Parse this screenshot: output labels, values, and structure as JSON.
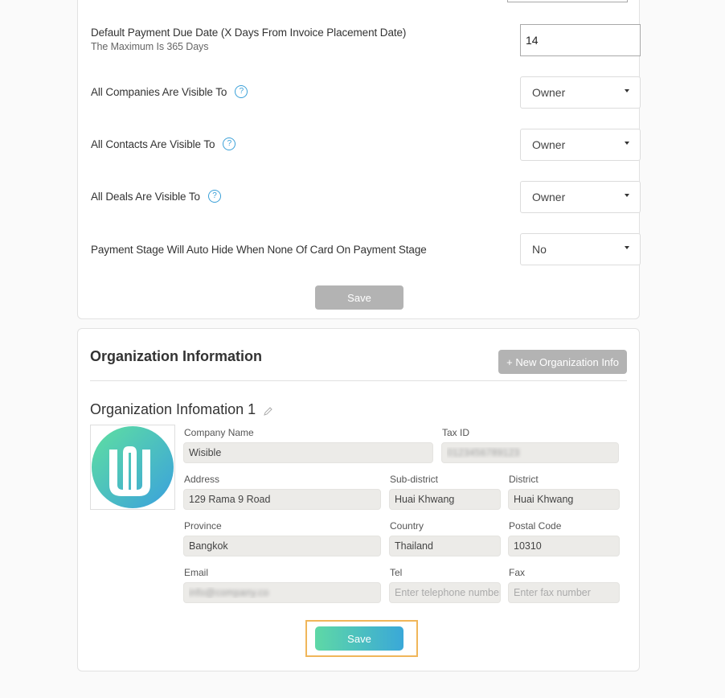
{
  "settings": {
    "payment_due": {
      "label": "Default Payment Due Date (X Days From Invoice Placement Date)",
      "sublabel": "The Maximum Is 365 Days",
      "value": "14"
    },
    "companies_visible": {
      "label": "All Companies Are Visible To",
      "value": "Owner"
    },
    "contacts_visible": {
      "label": "All Contacts Are Visible To",
      "value": "Owner"
    },
    "deals_visible": {
      "label": "All Deals Are Visible To",
      "value": "Owner"
    },
    "payment_stage_hide": {
      "label": "Payment Stage Will Auto Hide When None Of Card On Payment Stage",
      "value": "No"
    },
    "help_glyph": "?",
    "save_label": "Save"
  },
  "organization": {
    "title": "Organization Information",
    "new_button_label": "+ New Organization Info",
    "entry_title": "Organization Infomation 1",
    "fields": {
      "company_name": {
        "label": "Company Name",
        "value": "Wisible"
      },
      "tax_id": {
        "label": "Tax ID",
        "value": "0123456789123"
      },
      "address": {
        "label": "Address",
        "value": "129 Rama 9 Road"
      },
      "sub_district": {
        "label": "Sub-district",
        "value": "Huai Khwang"
      },
      "district": {
        "label": "District",
        "value": "Huai Khwang"
      },
      "province": {
        "label": "Province",
        "value": "Bangkok"
      },
      "country": {
        "label": "Country",
        "value": "Thailand"
      },
      "postal_code": {
        "label": "Postal Code",
        "value": "10310"
      },
      "email": {
        "label": "Email",
        "value": "info@company.co"
      },
      "tel": {
        "label": "Tel",
        "value": "",
        "placeholder": "Enter telephone number"
      },
      "fax": {
        "label": "Fax",
        "value": "",
        "placeholder": "Enter fax number"
      }
    },
    "save_label": "Save"
  },
  "colors": {
    "accent_green": "#5ed8a6",
    "accent_blue": "#3aa8d8",
    "highlight": "#f0b65a",
    "disabled_button": "#b3b3b3"
  }
}
